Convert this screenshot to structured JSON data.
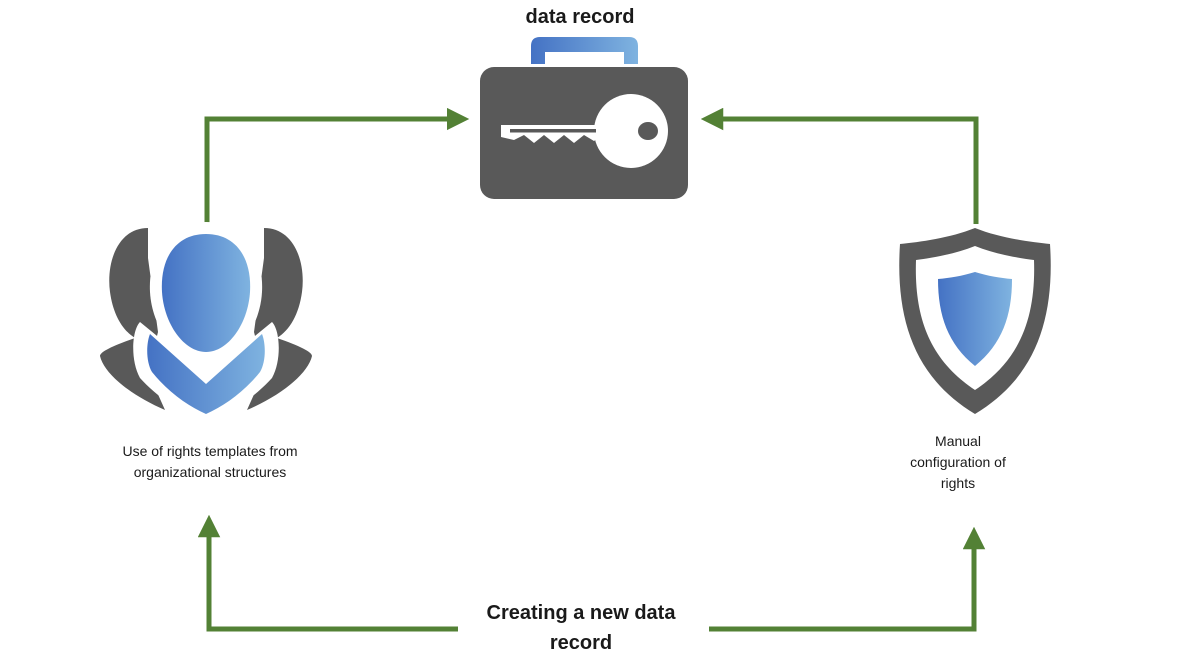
{
  "diagram": {
    "record_title": "data record",
    "new_record_label": "Creating a new data record",
    "template_caption": "Use of rights templates from organizational structures",
    "manual_caption": "Manual configuration of rights"
  },
  "icons": {
    "key_case": "briefcase-key-icon",
    "people": "user-group-icon",
    "shield": "shield-icon"
  },
  "colors": {
    "arrow": "#538135",
    "dark_gray": "#595959",
    "blue_start": "#4472c4",
    "blue_end": "#7fb3e0"
  }
}
